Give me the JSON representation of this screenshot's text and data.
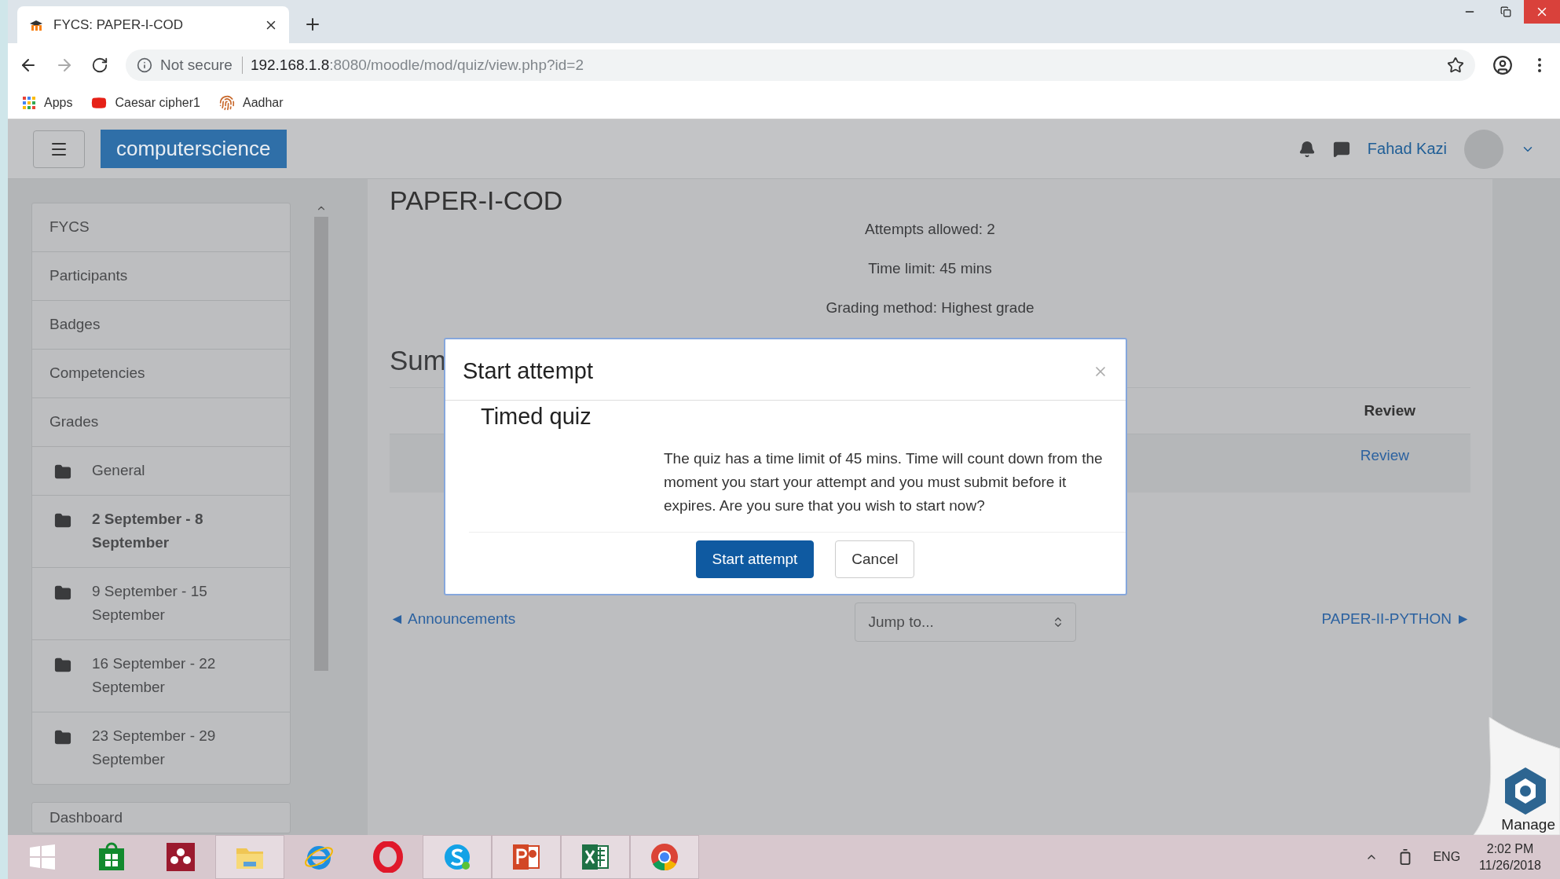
{
  "browser": {
    "tab": {
      "title": "FYCS: PAPER-I-COD"
    },
    "address": {
      "security": "Not secure",
      "host": "192.168.1.8",
      "path": ":8080/moodle/mod/quiz/view.php?id=2"
    },
    "bookmarks": [
      {
        "label": "Apps",
        "kind": "apps"
      },
      {
        "label": "Caesar cipher1",
        "kind": "video"
      },
      {
        "label": "Aadhar",
        "kind": "fingerprint"
      }
    ]
  },
  "navbar": {
    "site_name": "computerscience",
    "user_name": "Fahad Kazi"
  },
  "sidebar": {
    "items": [
      {
        "label": "FYCS",
        "kind": "link",
        "current": false
      },
      {
        "label": "Participants",
        "kind": "link",
        "current": false
      },
      {
        "label": "Badges",
        "kind": "link",
        "current": false
      },
      {
        "label": "Competencies",
        "kind": "link",
        "current": false
      },
      {
        "label": "Grades",
        "kind": "link",
        "current": false
      },
      {
        "label": "General",
        "kind": "section",
        "current": false
      },
      {
        "label": "2 September - 8 September",
        "kind": "section",
        "current": true
      },
      {
        "label": "9 September - 15 September",
        "kind": "section",
        "current": false
      },
      {
        "label": "16 September - 22 September",
        "kind": "section",
        "current": false
      },
      {
        "label": "23 September - 29 September",
        "kind": "section",
        "current": false
      }
    ],
    "bottom_items": [
      {
        "label": "Dashboard"
      }
    ]
  },
  "main": {
    "title": "PAPER-I-COD",
    "info": [
      "Attempts allowed: 2",
      "Time limit: 45 mins",
      "Grading method: Highest grade"
    ],
    "summary_heading": "Sum",
    "table": {
      "columns": [
        "Review"
      ],
      "rows": [
        [
          "Review"
        ]
      ]
    },
    "prev_link": "◄ Announcements",
    "jump": {
      "value": "Jump to..."
    },
    "next_link": "PAPER-II-PYTHON ►"
  },
  "modal": {
    "title": "Start attempt",
    "heading": "Timed quiz",
    "message": "The quiz has a time limit of 45 mins. Time will count down from the moment you start your attempt and you must submit before it expires. Are you sure that you wish to start now?",
    "buttons": [
      {
        "label": "Start attempt",
        "kind": "primary"
      },
      {
        "label": "Cancel",
        "kind": "secondary"
      }
    ]
  },
  "desktop_widget": {
    "label": "Manage"
  },
  "taskbar": {
    "apps": [
      {
        "kind": "start",
        "running": false
      },
      {
        "kind": "store",
        "running": false
      },
      {
        "kind": "mendeley",
        "running": false
      },
      {
        "kind": "folder",
        "running": true
      },
      {
        "kind": "ie",
        "running": false
      },
      {
        "kind": "opera",
        "running": false
      },
      {
        "kind": "skype",
        "running": true
      },
      {
        "kind": "powerpoint",
        "running": true
      },
      {
        "kind": "excel",
        "running": true
      },
      {
        "kind": "chrome",
        "running": true
      }
    ],
    "language": "ENG",
    "time": "2:02 PM",
    "date": "11/26/2018"
  }
}
